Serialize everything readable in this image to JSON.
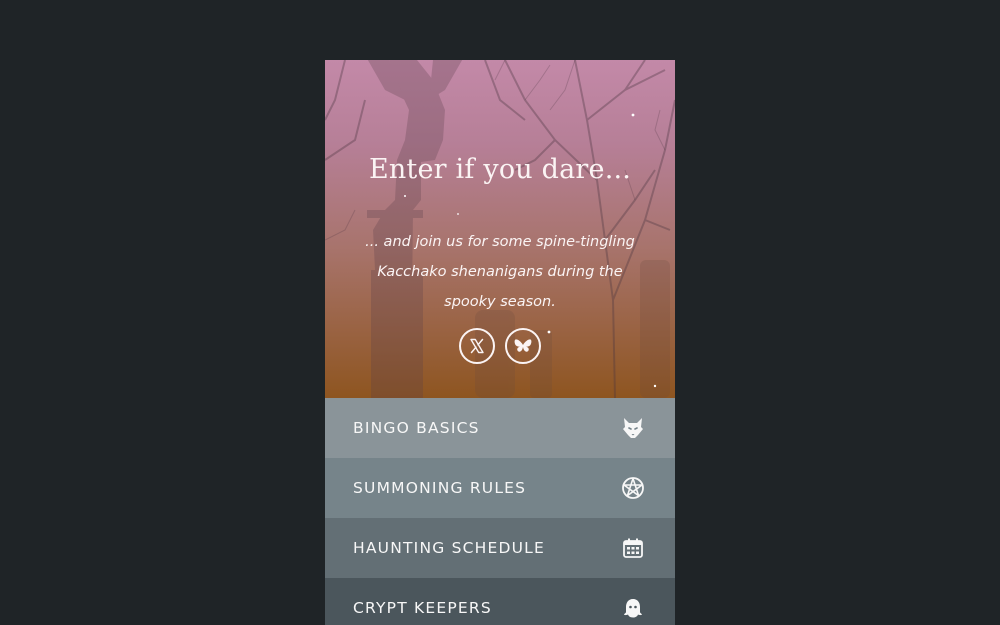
{
  "hero": {
    "title": "Enter if you dare...",
    "text": "... and join us for some spine-tingling Kacchako shenanigans during the spooky season."
  },
  "social": [
    {
      "name": "x",
      "icon": "x-logo-icon"
    },
    {
      "name": "bluesky",
      "icon": "butterfly-icon"
    }
  ],
  "menu": {
    "items": [
      {
        "label": "BINGO BASICS",
        "icon": "wolf-icon"
      },
      {
        "label": "SUMMONING RULES",
        "icon": "pentagram-icon"
      },
      {
        "label": "HAUNTING SCHEDULE",
        "icon": "calendar-icon"
      },
      {
        "label": "CRYPT KEEPERS",
        "icon": "ghost-icon"
      }
    ]
  },
  "colors": {
    "page_bg": "#1f2427",
    "hero_top": "#c389a8",
    "hero_bottom": "#8e5520",
    "menu_item_1": "#8a9499",
    "menu_item_2": "#76848a",
    "menu_item_3": "#636f75",
    "menu_item_4": "#4b565c",
    "text": "#fbf4f4"
  }
}
